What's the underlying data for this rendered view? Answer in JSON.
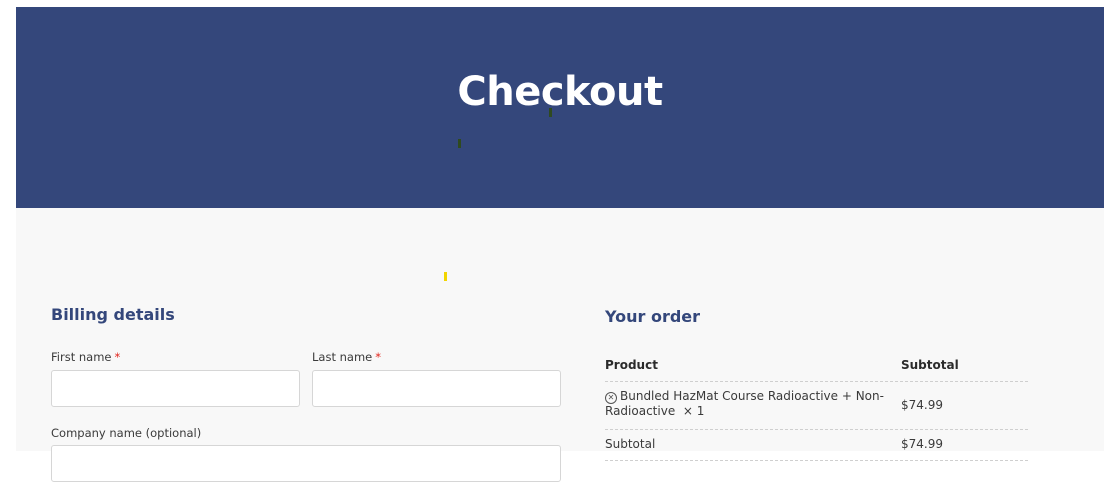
{
  "hero": {
    "title": "Checkout",
    "background_color": "#34477b"
  },
  "billing": {
    "title": "Billing details",
    "first_name": {
      "label": "First name",
      "required_mark": "*",
      "value": ""
    },
    "last_name": {
      "label": "Last name",
      "required_mark": "*",
      "value": ""
    },
    "company_name": {
      "label": "Company name (optional)",
      "value": ""
    }
  },
  "order": {
    "title": "Your order",
    "headers": {
      "product": "Product",
      "subtotal": "Subtotal"
    },
    "items": [
      {
        "remove_icon": "remove-circle-icon",
        "name": "Bundled HazMat Course Radioactive + Non-Radioactive",
        "quantity": "× 1",
        "price": "$74.99"
      }
    ],
    "subtotal": {
      "label": "Subtotal",
      "value": "$74.99"
    }
  },
  "colors": {
    "accent": "#34477b",
    "required": "#e2231a",
    "page_background": "#f8f8f8"
  }
}
